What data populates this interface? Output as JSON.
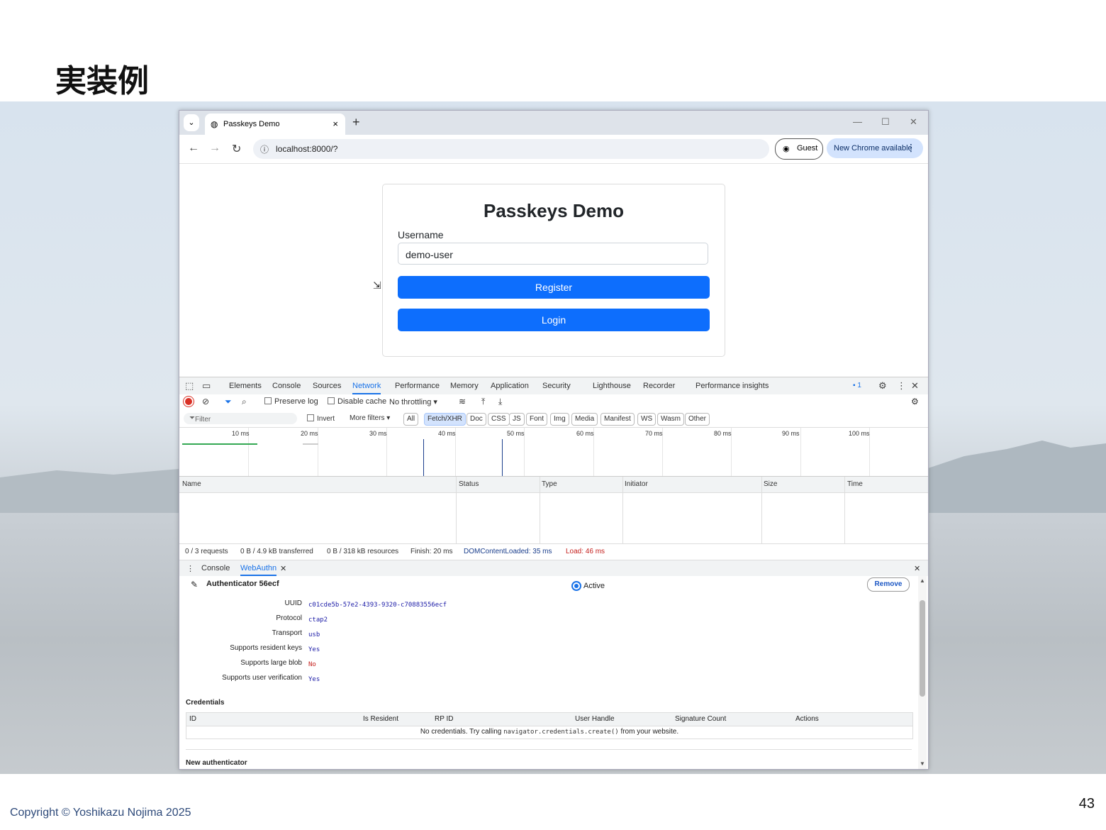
{
  "slide": {
    "title": "実装例",
    "copyright": "Copyright © Yoshikazu Nojima 2025",
    "page_number": "43"
  },
  "browser": {
    "tab_title": "Passkeys Demo",
    "url": "localhost:8000/?",
    "guest_label": "Guest",
    "update_label": "New Chrome available"
  },
  "app": {
    "heading": "Passkeys Demo",
    "username_label": "Username",
    "username_value": "demo-user",
    "register_label": "Register",
    "login_label": "Login"
  },
  "devtools": {
    "tabs": [
      "Elements",
      "Console",
      "Sources",
      "Network",
      "Performance",
      "Memory",
      "Application",
      "Security",
      "Lighthouse",
      "Recorder",
      "Performance insights"
    ],
    "active_tab": "Network",
    "issues_count": "1",
    "toolbar": {
      "preserve_log": "Preserve log",
      "disable_cache": "Disable cache",
      "throttling": "No throttling"
    },
    "filter": {
      "placeholder": "Filter",
      "invert": "Invert",
      "more_filters": "More filters",
      "chips": [
        "All",
        "Fetch/XHR",
        "Doc",
        "CSS",
        "JS",
        "Font",
        "Img",
        "Media",
        "Manifest",
        "WS",
        "Wasm",
        "Other"
      ],
      "active_chip": "Fetch/XHR"
    },
    "timeline_labels": [
      "10 ms",
      "20 ms",
      "30 ms",
      "40 ms",
      "50 ms",
      "60 ms",
      "70 ms",
      "80 ms",
      "90 ms",
      "100 ms"
    ],
    "columns": [
      "Name",
      "Status",
      "Type",
      "Initiator",
      "Size",
      "Time"
    ],
    "summary": {
      "requests": "0 / 3 requests",
      "transferred": "0 B / 4.9 kB transferred",
      "resources": "0 B / 318 kB resources",
      "finish": "Finish: 20 ms",
      "dcl": "DOMContentLoaded: 35 ms",
      "load": "Load: 46 ms"
    },
    "drawer_tabs": [
      "Console",
      "WebAuthn"
    ],
    "webauthn": {
      "authenticator_name": "Authenticator 56ecf",
      "active_label": "Active",
      "remove_label": "Remove",
      "properties": [
        {
          "label": "UUID",
          "value": "c01cde5b-57e2-4393-9320-c70883556ecf"
        },
        {
          "label": "Protocol",
          "value": "ctap2"
        },
        {
          "label": "Transport",
          "value": "usb"
        },
        {
          "label": "Supports resident keys",
          "value": "Yes"
        },
        {
          "label": "Supports large blob",
          "value": "No"
        },
        {
          "label": "Supports user verification",
          "value": "Yes"
        }
      ],
      "credentials_title": "Credentials",
      "cred_columns": [
        "ID",
        "Is Resident",
        "RP ID",
        "User Handle",
        "Signature Count",
        "Actions"
      ],
      "cred_empty_pre": "No credentials. Try calling ",
      "cred_empty_code": "navigator.credentials.create()",
      "cred_empty_post": " from your website.",
      "new_authenticator": "New authenticator"
    }
  }
}
